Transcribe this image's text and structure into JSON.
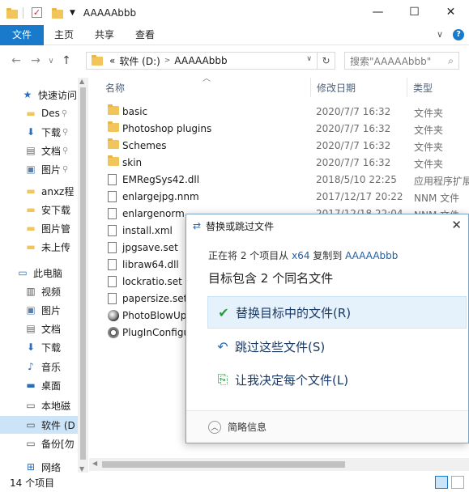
{
  "window": {
    "title": "AAAAAbbb",
    "controls": {
      "minimize": "—",
      "maximize": "☐",
      "close": "✕"
    }
  },
  "ribbon": {
    "tabs": [
      "文件",
      "主页",
      "共享",
      "查看"
    ],
    "help": "?"
  },
  "nav": {
    "back": "←",
    "forward": "→",
    "recent": "∨",
    "up": "↑",
    "breadcrumb_overflow": "«",
    "breadcrumb": [
      "软件 (D:)",
      "AAAAAbbb"
    ],
    "refresh": "↻",
    "search_placeholder": "搜索\"AAAAAbbb\""
  },
  "sidebar": {
    "items": [
      {
        "label": "快速访问",
        "icon": "star-icon"
      },
      {
        "label": "Des",
        "icon": "folder-icon",
        "pinned": true
      },
      {
        "label": "下载",
        "icon": "download-icon",
        "pinned": true
      },
      {
        "label": "文档",
        "icon": "document-icon",
        "pinned": true
      },
      {
        "label": "图片",
        "icon": "picture-icon",
        "pinned": true
      },
      {
        "label": "anxz程",
        "icon": "folder-icon"
      },
      {
        "label": "安下载",
        "icon": "folder-icon"
      },
      {
        "label": "图片管",
        "icon": "folder-icon"
      },
      {
        "label": "未上传",
        "icon": "folder-icon"
      },
      {
        "label": "此电脑",
        "icon": "computer-icon"
      },
      {
        "label": "视频",
        "icon": "video-icon"
      },
      {
        "label": "图片",
        "icon": "picture-icon"
      },
      {
        "label": "文档",
        "icon": "document-icon"
      },
      {
        "label": "下载",
        "icon": "download-icon"
      },
      {
        "label": "音乐",
        "icon": "music-icon"
      },
      {
        "label": "桌面",
        "icon": "desktop-icon"
      },
      {
        "label": "本地磁",
        "icon": "drive-icon"
      },
      {
        "label": "软件 (D",
        "icon": "drive-icon",
        "selected": true
      },
      {
        "label": "备份[勿",
        "icon": "drive-icon"
      },
      {
        "label": "网络",
        "icon": "network-icon"
      }
    ]
  },
  "list": {
    "columns": {
      "name": "名称",
      "date": "修改日期",
      "type": "类型"
    },
    "files": [
      {
        "name": "basic",
        "date": "2020/7/7 16:32",
        "type": "文件夹",
        "icon": "folder-icon"
      },
      {
        "name": "Photoshop plugins",
        "date": "2020/7/7 16:32",
        "type": "文件夹",
        "icon": "folder-icon"
      },
      {
        "name": "Schemes",
        "date": "2020/7/7 16:32",
        "type": "文件夹",
        "icon": "folder-icon"
      },
      {
        "name": "skin",
        "date": "2020/7/7 16:32",
        "type": "文件夹",
        "icon": "folder-icon"
      },
      {
        "name": "EMRegSys42.dll",
        "date": "2018/5/10 22:25",
        "type": "应用程序扩展",
        "icon": "dll-icon"
      },
      {
        "name": "enlargejpg.nnm",
        "date": "2017/12/17 20:22",
        "type": "NNM 文件",
        "icon": "file-icon"
      },
      {
        "name": "enlargenorm",
        "date": "2017/12/18 22:04",
        "type": "NNM 文件",
        "icon": "file-icon"
      },
      {
        "name": "install.xml",
        "date": "",
        "type": "",
        "icon": "xml-icon"
      },
      {
        "name": "jpgsave.set",
        "date": "",
        "type": "",
        "icon": "file-icon"
      },
      {
        "name": "libraw64.dll",
        "date": "",
        "type": "",
        "icon": "dll-icon"
      },
      {
        "name": "lockratio.set",
        "date": "",
        "type": "",
        "icon": "file-icon"
      },
      {
        "name": "papersize.set",
        "date": "",
        "type": "",
        "icon": "file-icon"
      },
      {
        "name": "PhotoBlowUp",
        "date": "",
        "type": "",
        "icon": "app-orb-icon"
      },
      {
        "name": "PlugInConfigu",
        "date": "",
        "type": "",
        "icon": "gear-icon"
      }
    ]
  },
  "status": {
    "count": "14 个项目"
  },
  "dialog": {
    "title": "替换或跳过文件",
    "close": "✕",
    "subtitle_prefix": "正在将 2 个项目从",
    "subtitle_source": "x64",
    "subtitle_middle": "复制到",
    "subtitle_dest": "AAAAAbbb",
    "heading": "目标包含 2 个同名文件",
    "options": [
      {
        "label": "替换目标中的文件(R)",
        "icon": "checkmark-icon",
        "glyph": "✔"
      },
      {
        "label": "跳过这些文件(S)",
        "icon": "skip-arrow-icon",
        "glyph": "↶"
      },
      {
        "label": "让我决定每个文件(L)",
        "icon": "choose-files-icon",
        "glyph": "⎘"
      }
    ],
    "details": "简略信息",
    "details_glyph": "︿"
  },
  "colors": {
    "accent": "#1979ca",
    "selection": "#cce4f7",
    "folder": "#f2c55c",
    "link": "#1f5fa8"
  }
}
